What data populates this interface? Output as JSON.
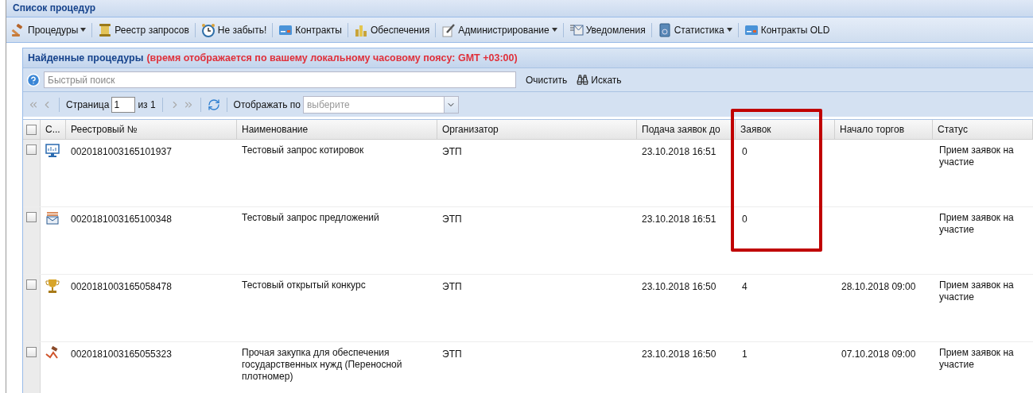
{
  "window": {
    "title": "Список процедур"
  },
  "toolbar": [
    {
      "label": "Процедуры",
      "kind": "gavel",
      "dropdown": true
    },
    {
      "label": "Реестр запросов",
      "kind": "scroll",
      "dropdown": false
    },
    {
      "label": "Не забыть!",
      "kind": "clock",
      "dropdown": false
    },
    {
      "label": "Контракты",
      "kind": "card",
      "dropdown": false
    },
    {
      "label": "Обеспечения",
      "kind": "coins",
      "dropdown": false
    },
    {
      "label": "Администрирование",
      "kind": "pen",
      "dropdown": true
    },
    {
      "label": "Уведомления",
      "kind": "mail",
      "dropdown": false
    },
    {
      "label": "Статистика",
      "kind": "book",
      "dropdown": true
    },
    {
      "label": "Контракты OLD",
      "kind": "card",
      "dropdown": false
    }
  ],
  "panel": {
    "title": "Найденные процедуры",
    "note": "(время отображается по вашему локальному часовому поясу: GMT +03:00)"
  },
  "search": {
    "placeholder": "Быстрый поиск",
    "clear": "Очистить",
    "find": "Искать"
  },
  "paging": {
    "page_label": "Страница",
    "page": "1",
    "of": "из 1",
    "per_page_label": "Отображать по",
    "per_page_placeholder": "выберите"
  },
  "table": {
    "select_all": {
      "checked": false
    },
    "columns": [
      {
        "label": "С...",
        "highlighted": false
      },
      {
        "label": "Реестровый №",
        "highlighted": false
      },
      {
        "label": "Наименование",
        "highlighted": false
      },
      {
        "label": "Организатор",
        "highlighted": false
      },
      {
        "label": "Подача заявок до",
        "highlighted": false
      },
      {
        "label": "Заявок",
        "highlighted": true
      },
      {
        "label": "Начало торгов",
        "highlighted": false
      },
      {
        "label": "Статус",
        "highlighted": false
      }
    ],
    "rows": [
      {
        "checked": false,
        "kind": "monitor",
        "number": "0020181003165101937",
        "name": "Тестовый запрос котировок",
        "organizer": "ЭТП",
        "deadline": "23.10.2018 16:51",
        "bids": "0",
        "start": "",
        "status": "Прием заявок на участие"
      },
      {
        "checked": false,
        "kind": "tray",
        "number": "0020181003165100348",
        "name": "Тестовый запрос предложений",
        "organizer": "ЭТП",
        "deadline": "23.10.2018 16:51",
        "bids": "0",
        "start": "",
        "status": "Прием заявок на участие"
      },
      {
        "checked": false,
        "kind": "trophy",
        "number": "0020181003165058478",
        "name": "Тестовый открытый конкурс",
        "organizer": "ЭТП",
        "deadline": "23.10.2018 16:50",
        "bids": "4",
        "start": "28.10.2018 09:00",
        "status": "Прием заявок на участие"
      },
      {
        "checked": false,
        "kind": "hammer",
        "number": "0020181003165055323",
        "name": "Прочая закупка для обеспечения государственных нужд (Переносной плотномер)",
        "organizer": "ЭТП",
        "deadline": "23.10.2018 16:50",
        "bids": "1",
        "start": "07.10.2018 09:00",
        "status": "Прием заявок на участие"
      }
    ]
  }
}
